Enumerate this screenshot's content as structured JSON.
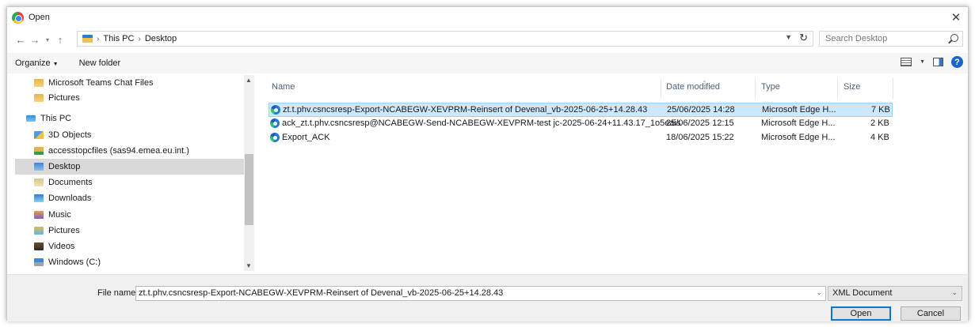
{
  "window": {
    "title": "Open"
  },
  "address": {
    "crumbs": [
      "This PC",
      "Desktop"
    ],
    "search_placeholder": "Search Desktop"
  },
  "toolbar": {
    "organize_label": "Organize",
    "new_folder_label": "New folder"
  },
  "nav": {
    "items": [
      {
        "label": "Microsoft Teams Chat Files",
        "icon": "folder-icon"
      },
      {
        "label": "Pictures",
        "icon": "folder-icon"
      },
      {
        "label": "This PC",
        "icon": "computer-icon"
      },
      {
        "label": "3D Objects",
        "icon": "3d-objects-icon"
      },
      {
        "label": "accesstopcfiles (sas94.emea.eu.int.)",
        "icon": "network-drive-icon"
      },
      {
        "label": "Desktop",
        "icon": "desktop-icon",
        "selected": true
      },
      {
        "label": "Documents",
        "icon": "documents-icon"
      },
      {
        "label": "Downloads",
        "icon": "downloads-icon"
      },
      {
        "label": "Music",
        "icon": "music-icon"
      },
      {
        "label": "Pictures",
        "icon": "pictures-icon"
      },
      {
        "label": "Videos",
        "icon": "videos-icon"
      },
      {
        "label": "Windows (C:)",
        "icon": "drive-icon"
      }
    ]
  },
  "files": {
    "columns": {
      "name": "Name",
      "date": "Date modified",
      "type": "Type",
      "size": "Size"
    },
    "rows": [
      {
        "name": "zt.t.phv.csncsresp-Export-NCABEGW-XEVPRM-Reinsert of Devenal_vb-2025-06-25+14.28.43",
        "date": "25/06/2025 14:28",
        "type": "Microsoft Edge H...",
        "size": "7 KB",
        "selected": true
      },
      {
        "name": "ack_zt.t.phv.csncsresp@NCABEGW-Send-NCABEGW-XEVPRM-test jc-2025-06-24+11.43.17_1o5eais",
        "date": "25/06/2025 12:15",
        "type": "Microsoft Edge H...",
        "size": "2 KB"
      },
      {
        "name": "Export_ACK",
        "date": "18/06/2025 15:22",
        "type": "Microsoft Edge H...",
        "size": "4 KB"
      }
    ]
  },
  "bottom": {
    "file_name_label": "File name:",
    "file_name_value": "zt.t.phv.csncsresp-Export-NCABEGW-XEVPRM-Reinsert of Devenal_vb-2025-06-25+14.28.43",
    "file_type": "XML Document",
    "open_label": "Open",
    "cancel_label": "Cancel"
  }
}
